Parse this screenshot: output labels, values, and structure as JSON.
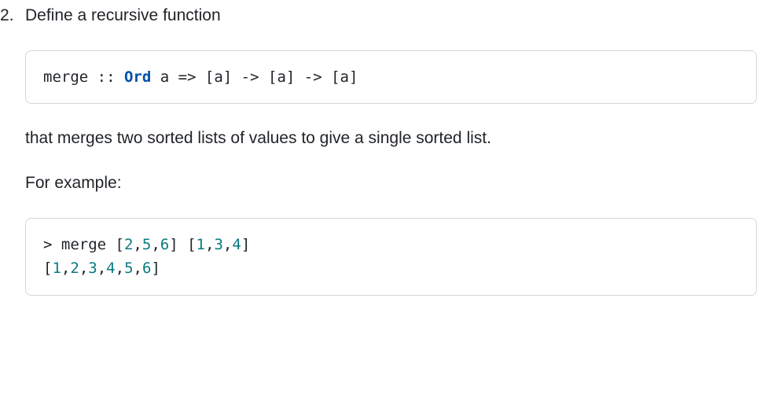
{
  "question": {
    "number": "2.",
    "intro": "Define a recursive function",
    "description": "that merges two sorted lists of values to give a single sorted list.",
    "example_label": "For example:"
  },
  "signature": {
    "fn": "merge ",
    "dcolon": ":: ",
    "classname": "Ord",
    "rest": " a => [a] -> [a] -> [a]"
  },
  "example": {
    "prompt": "> merge [",
    "n1": "2",
    "c1": ",",
    "n2": "5",
    "c2": ",",
    "n3": "6",
    "mid": "] [",
    "n4": "1",
    "c3": ",",
    "n5": "3",
    "c4": ",",
    "n6": "4",
    "end1": "]",
    "out_open": "[",
    "o1": "1",
    "oc1": ",",
    "o2": "2",
    "oc2": ",",
    "o3": "3",
    "oc3": ",",
    "o4": "4",
    "oc4": ",",
    "o5": "5",
    "oc5": ",",
    "o6": "6",
    "out_close": "]"
  }
}
